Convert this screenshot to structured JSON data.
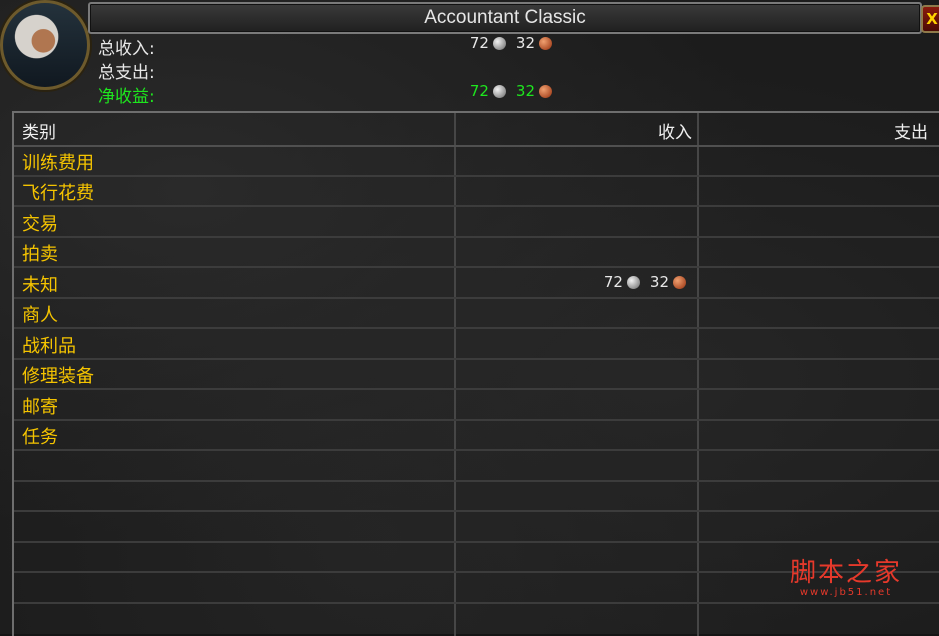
{
  "window": {
    "title": "Accountant Classic",
    "close_glyph": "X"
  },
  "summary": {
    "total_income": {
      "label": "总收入:",
      "silver": "72",
      "copper": "32"
    },
    "total_expense": {
      "label": "总支出:"
    },
    "net_profit": {
      "label": "净收益:",
      "silver": "72",
      "copper": "32",
      "color": "#1ee61e"
    }
  },
  "table": {
    "headers": {
      "category": "类别",
      "income": "收入",
      "expense": "支出"
    },
    "rows": [
      {
        "category": "训练费用"
      },
      {
        "category": "飞行花费"
      },
      {
        "category": "交易"
      },
      {
        "category": "拍卖"
      },
      {
        "category": "未知",
        "income_silver": "72",
        "income_copper": "32"
      },
      {
        "category": "商人"
      },
      {
        "category": "战利品"
      },
      {
        "category": "修理装备"
      },
      {
        "category": "邮寄"
      },
      {
        "category": "任务"
      }
    ]
  },
  "watermark": {
    "main": "脚本之家",
    "sub": "www.jb51.net"
  },
  "colors": {
    "category_text": "#f5c400",
    "accent_close": "#8a1a0d"
  }
}
